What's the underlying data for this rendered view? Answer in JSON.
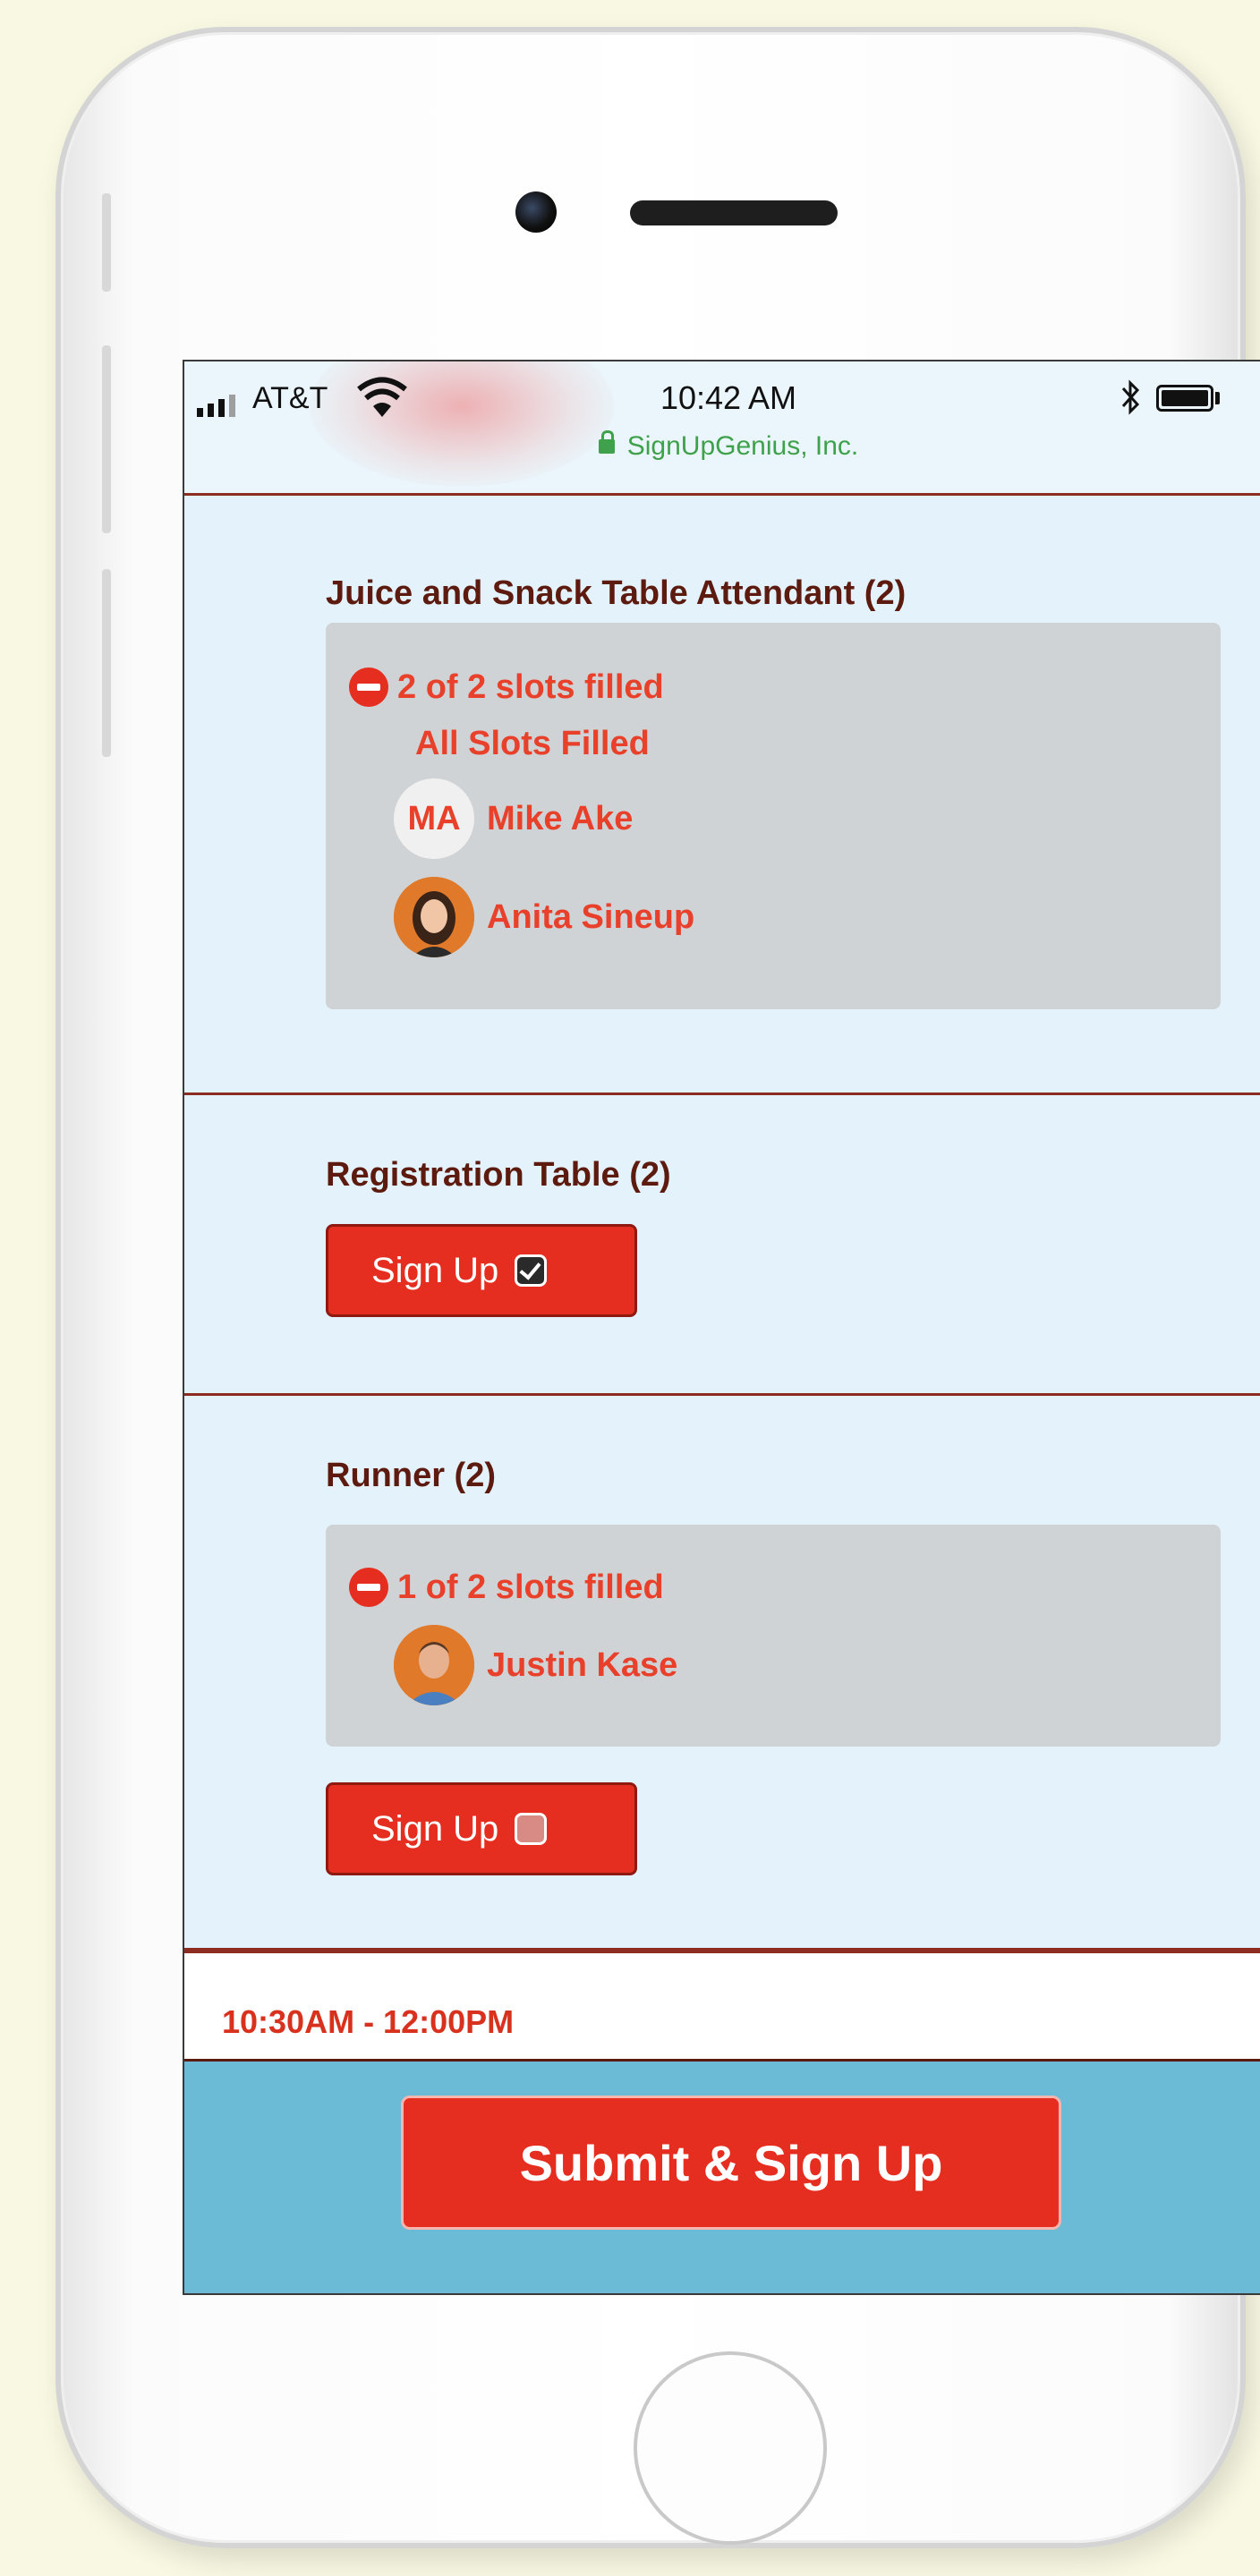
{
  "status_bar": {
    "carrier": "AT&T",
    "time": "10:42 AM",
    "site": "SignUpGenius, Inc."
  },
  "sections": [
    {
      "title": "Juice and Snack Table Attendant (2)",
      "filled_text": "2 of 2 slots filled",
      "all_filled_text": "All Slots Filled",
      "people": [
        {
          "initials": "MA",
          "name": "Mike Ake"
        },
        {
          "name": "Anita Sineup"
        }
      ]
    },
    {
      "title": "Registration Table (2)",
      "signup_label": "Sign Up",
      "checked": true
    },
    {
      "title": "Runner (2)",
      "filled_text": "1 of 2 slots filled",
      "people": [
        {
          "name": "Justin Kase"
        }
      ],
      "signup_label": "Sign Up",
      "checked": false
    }
  ],
  "next_time_slot": "10:30AM - 12:00PM",
  "submit_label": "Submit & Sign Up",
  "colors": {
    "accent_red": "#e52e1f",
    "text_red": "#e8402a",
    "title_brown": "#5d1b10",
    "screen_bg": "#e4f3fb",
    "footer_blue": "#6bbbd6"
  }
}
